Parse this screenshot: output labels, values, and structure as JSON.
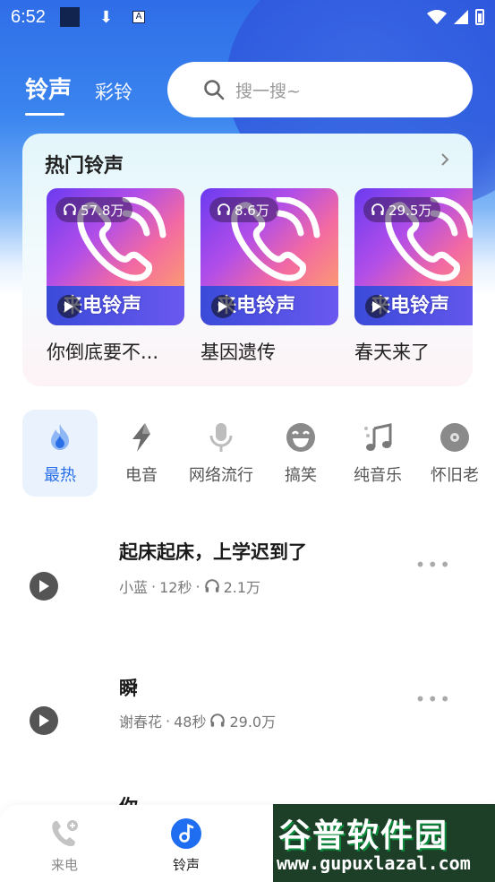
{
  "status_bar": {
    "time": "6:52",
    "a_badge": "A"
  },
  "top_tabs": [
    {
      "label": "铃声",
      "active": true
    },
    {
      "label": "彩铃",
      "active": false
    }
  ],
  "search": {
    "placeholder": "搜一搜~"
  },
  "hot": {
    "title": "热门铃声",
    "items": [
      {
        "plays": "57.8万",
        "band": "来电铃声",
        "name": "你倒底要不..."
      },
      {
        "plays": "8.6万",
        "band": "来电铃声",
        "name": "基因遗传"
      },
      {
        "plays": "29.5万",
        "band": "来电铃声",
        "name": "春天来了"
      }
    ]
  },
  "categories": [
    {
      "label": "最热",
      "icon": "flame-icon",
      "active": true
    },
    {
      "label": "电音",
      "icon": "lightning-icon",
      "active": false
    },
    {
      "label": "网络流行",
      "icon": "microphone-icon",
      "active": false
    },
    {
      "label": "搞笑",
      "icon": "laughing-face-icon",
      "active": false
    },
    {
      "label": "纯音乐",
      "icon": "music-note-icon",
      "active": false
    },
    {
      "label": "怀旧老",
      "icon": "disc-icon",
      "active": false
    }
  ],
  "songs": [
    {
      "title": "起床起床，上学迟到了",
      "artist": "小蓝",
      "duration": "12秒",
      "plays": "2.1万"
    },
    {
      "title": "瞬",
      "artist": "谢春花",
      "duration": "48秒",
      "plays": "29.0万"
    },
    {
      "title": "你",
      "artist": "",
      "duration": "",
      "plays": ""
    }
  ],
  "bottom_nav": [
    {
      "label": "来电",
      "icon": "phone-icon",
      "active": false
    },
    {
      "label": "铃声",
      "icon": "music-disc-icon",
      "active": true
    }
  ],
  "watermark": {
    "title": "谷普软件园",
    "url": "www.gupuxlazal.com"
  },
  "colors": {
    "accent": "#2a6fe6",
    "header_blue": "#2f6de8"
  }
}
